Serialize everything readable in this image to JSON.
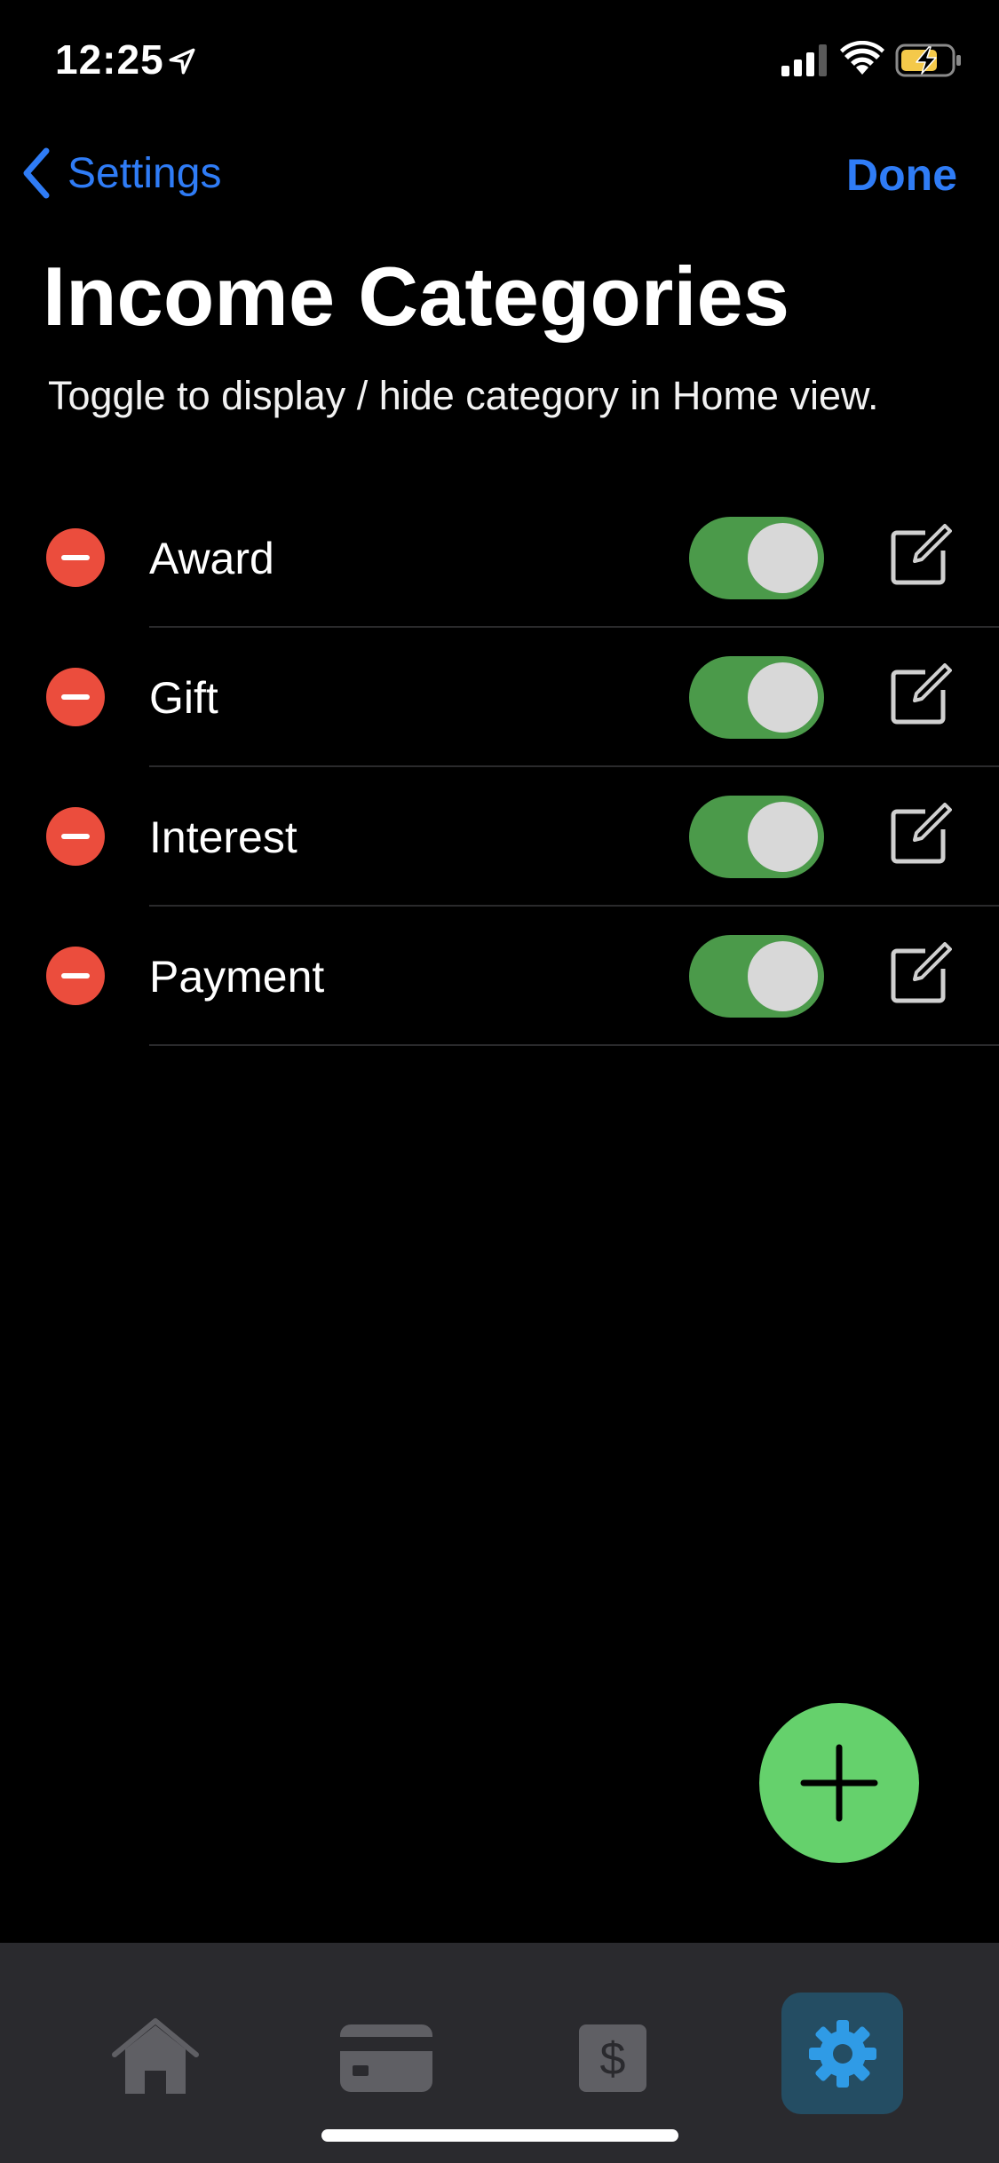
{
  "status_bar": {
    "time": "12:25"
  },
  "nav": {
    "back_label": "Settings",
    "done_label": "Done"
  },
  "page": {
    "title": "Income Categories",
    "subtitle": "Toggle to display / hide category in Home view."
  },
  "categories": [
    {
      "label": "Award",
      "visible": true
    },
    {
      "label": "Gift",
      "visible": true
    },
    {
      "label": "Interest",
      "visible": true
    },
    {
      "label": "Payment",
      "visible": true
    }
  ],
  "colors": {
    "accent": "#2f7cf6",
    "delete": "#eb4d3d",
    "toggle_on": "#4b9a4a",
    "fab": "#65d16c",
    "tab_bar": "#2a2a2e",
    "tab_active_bg": "#244d63",
    "tab_active_icon": "#2f9be6"
  },
  "tabs": [
    {
      "icon": "home-icon",
      "active": false
    },
    {
      "icon": "card-icon",
      "active": false
    },
    {
      "icon": "dollar-icon",
      "active": false
    },
    {
      "icon": "gear-icon",
      "active": true
    }
  ]
}
